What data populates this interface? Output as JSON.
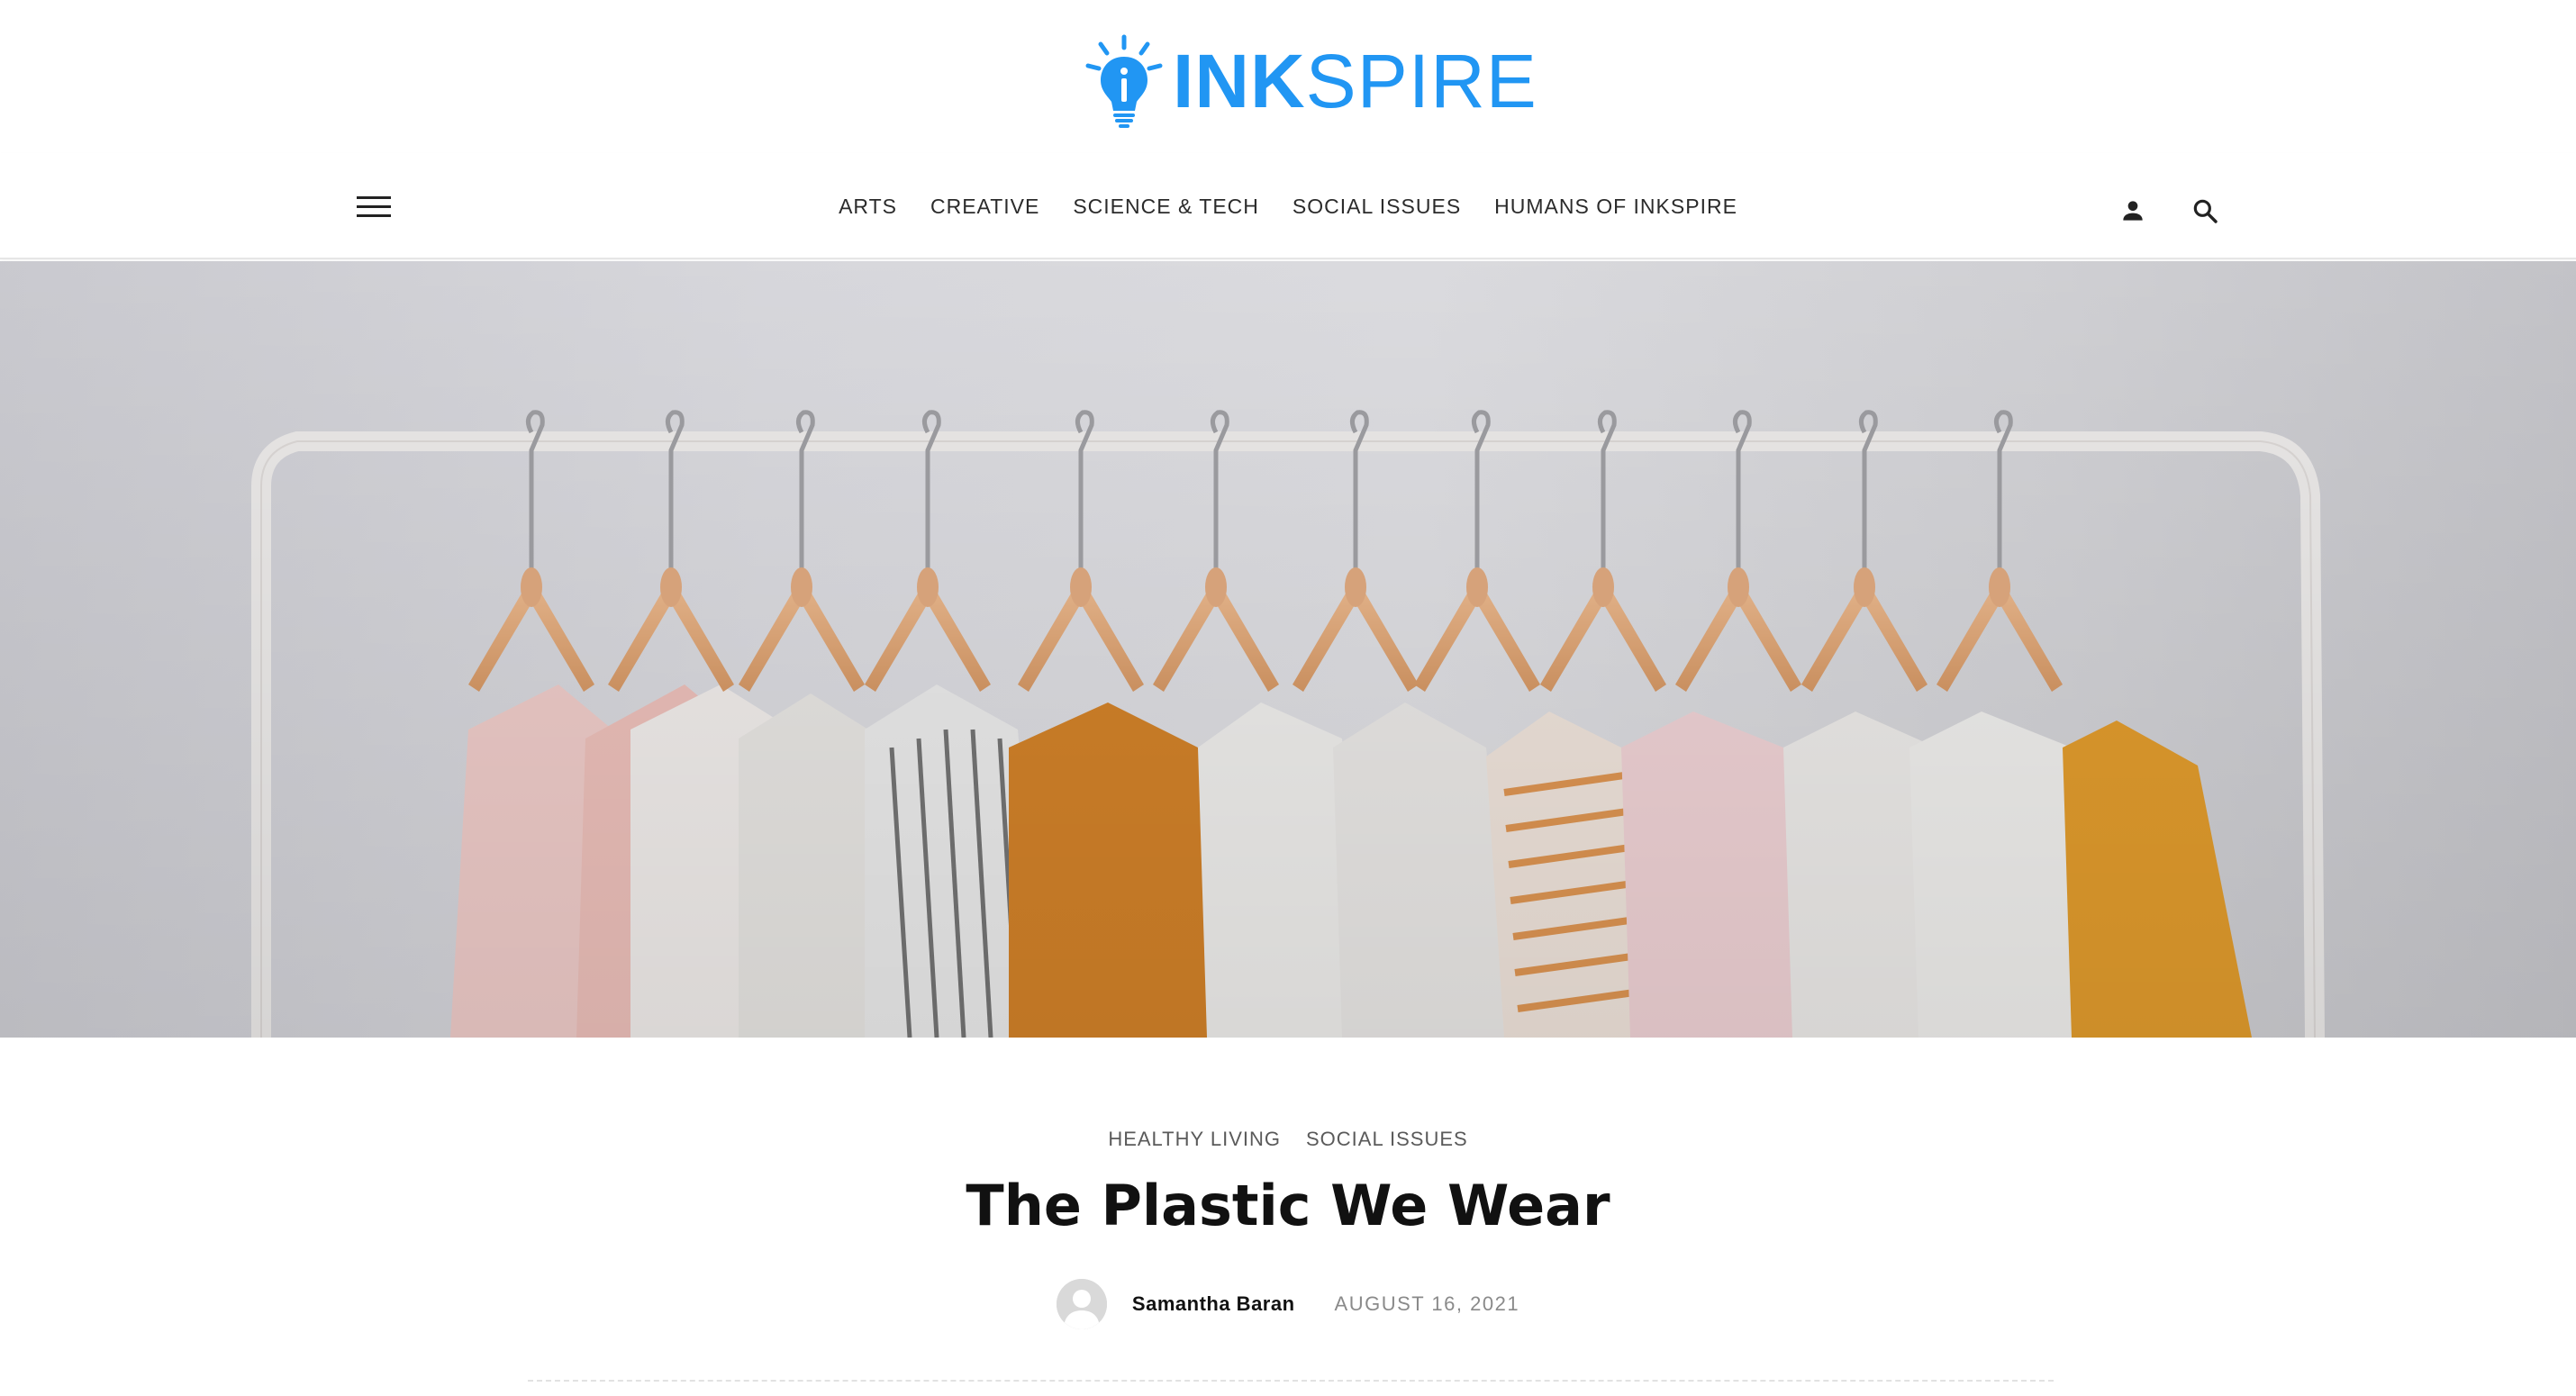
{
  "brand": {
    "logo_bold": "INK",
    "logo_light": "SPIRE",
    "logo_color": "#2196f3"
  },
  "nav": {
    "menu_icon": "hamburger-menu-icon",
    "items": [
      {
        "label": "ARTS"
      },
      {
        "label": "CREATIVE"
      },
      {
        "label": "SCIENCE & TECH"
      },
      {
        "label": "SOCIAL ISSUES"
      },
      {
        "label": "HUMANS OF INKSPIRE"
      }
    ],
    "account_icon": "user-icon",
    "search_icon": "search-icon"
  },
  "hero": {
    "image": "clothes-on-hangers-rack"
  },
  "article": {
    "categories": [
      "HEALTHY LIVING",
      "SOCIAL ISSUES"
    ],
    "title": "The Plastic We Wear",
    "author": "Samantha Baran",
    "date": "AUGUST 16, 2021"
  }
}
